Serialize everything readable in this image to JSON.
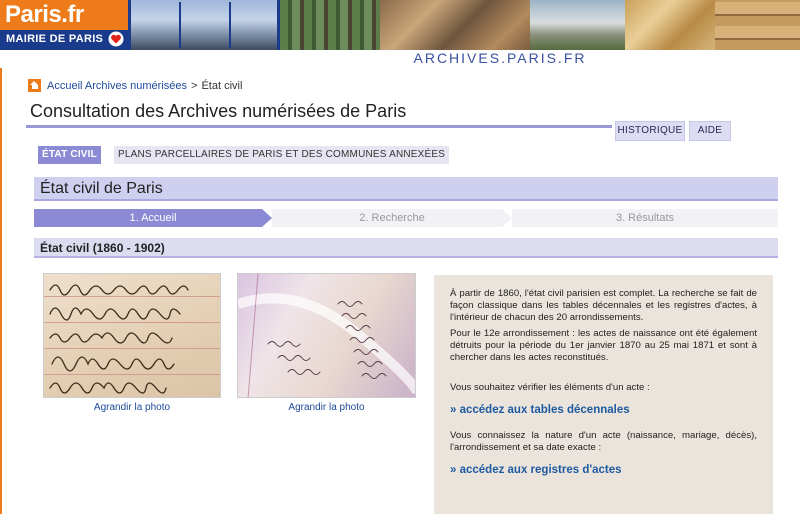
{
  "header": {
    "logo_text": "Paris.fr",
    "logo_subtitle": "MAIRIE DE PARIS",
    "site_title": "ARCHIVES.PARIS.FR"
  },
  "breadcrumb": {
    "home_link": "Accueil Archives numérisées",
    "separator": ">",
    "current": "État civil"
  },
  "page": {
    "title": "Consultation des Archives numérisées de Paris"
  },
  "top_nav": {
    "historique": "HISTORIQUE",
    "aide": "AIDE"
  },
  "tabs": {
    "etat_civil": "ÉTAT CIVIL",
    "plans": "PLANS PARCELLAIRES DE PARIS ET DES COMMUNES ANNEXÉES"
  },
  "section": {
    "title": "État civil de Paris"
  },
  "steps": [
    "1. Accueil",
    "2. Recherche",
    "3. Résultats"
  ],
  "subsection": {
    "title": "État civil (1860 - 1902)"
  },
  "photos": {
    "caption_1": "Agrandir la photo",
    "caption_2": "Agrandir la photo"
  },
  "info": {
    "para_1": "À partir de 1860, l'état civil parisien est complet. La recherche se fait de façon classique dans les tables décennales et les registres d'actes, à l'intérieur de chacun des 20 arrondissements.",
    "para_2": "Pour le 12e arrondissement : les actes de naissance ont été également détruits pour la période du 1er janvier 1870 au 25 mai 1871 et sont à chercher dans les actes reconstitués.",
    "verify_text": "Vous souhaitez vérifier les éléments d'un acte :",
    "link_tables": "» accédez aux tables décennales",
    "know_text": "Vous connaissez la nature d'un acte (naissance, mariage, décès), l'arrondissement et sa date exacte :",
    "link_registres": "» accédez aux registres d'actes"
  },
  "colors": {
    "accent_purple": "#8c8ad4",
    "orange": "#ee7b1a",
    "navy": "#1a3a8c",
    "link_blue": "#1e5aa0"
  }
}
